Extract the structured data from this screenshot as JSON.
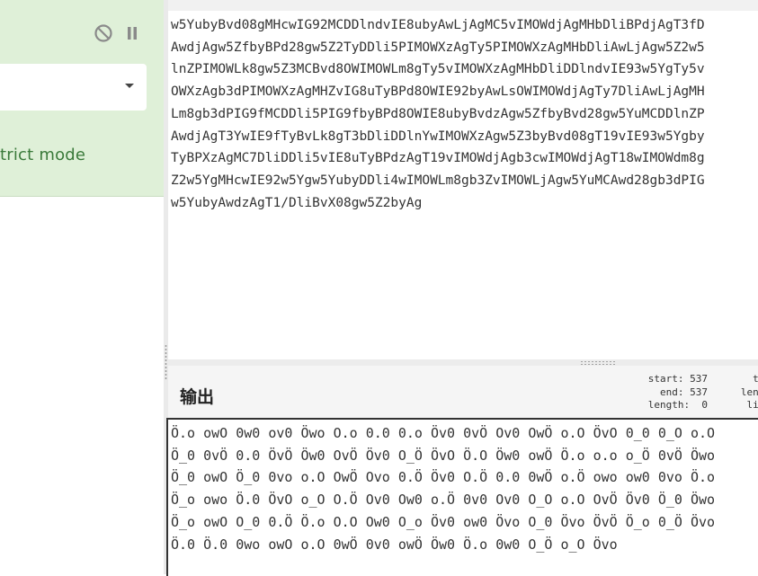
{
  "recipe": {
    "disable_icon": "circle-slash-icon",
    "pause_icon": "pause-icon",
    "select_value": "",
    "strict_mode_label": "trict mode"
  },
  "input": {
    "lines": [
      "w5YubyBvd08gMHcwIG92MCDDlndvIE8ubyAwLjAgMC5vIMOWdjAgMHbDliBPdjAgT3fD",
      "AwdjAgw5ZfbyBPd28gw5Z2TyDDli5PIMOWXzAgTy5PIMOWXzAgMHbDliAwLjAgw5Z2w5",
      "lnZPIMOWLk8gw5Z3MCBvd8OWIMOWLm8gTy5vIMOWXzAgMHbDliDDlndvIE93w5YgTy5v",
      "OWXzAgb3dPIMOWXzAgMHZvIG8uTyBPd8OWIE92byAwLsOWIMOWdjAgTy7DliAwLjAgMH",
      "Lm8gb3dPIG9fMCDDli5PIG9fbyBPd8OWIE8ubyBvdzAgw5ZfbyBvd28gw5YuMCDDlnZP",
      "AwdjAgT3YwIE9fTyBvLk8gT3bDliDDlnYwIMOWXzAgw5Z3byBvd08gT19vIE93w5Ygby",
      "TyBPXzAgMC7DliDDli5vIE8uTyBPdzAgT19vIMOWdjAgb3cwIMOWdjAgT18wIMOWdm8g",
      "Z2w5YgMHcwIE92w5Ygw5YubyDDli4wIMOWLm8gb3ZvIMOWLjAgw5YuMCAwd28gb3dPIG",
      "w5YubyAwdzAgT1/DliBvX08gw5Z2byAg"
    ]
  },
  "output": {
    "title": "输出",
    "stats_left": "start: 537\n  end: 537\nlength:  0",
    "stats_right": "tim\nlengt\nline",
    "lines": [
      "Ö.o owO 0w0 ov0 Öwo O.o 0.0 0.o Öv0 0vÖ Ov0 OwÖ o.O ÖvO 0_0 0_O o.O",
      "Ö_0 0vÖ 0.0 ÖvÖ Öw0 OvÖ Öv0 O_Ö ÖvO Ö.O Öw0 owÖ Ö.o o.o o_Ö 0vÖ Öwo",
      "Ö_0 owO Ö_0 0vo o.O OwÖ Ovo 0.Ö Öv0 O.Ö 0.0 0wÖ o.Ö owo ow0 0vo Ö.o",
      "Ö_o owo Ö.0 ÖvO o_O O.Ö Ov0 Ow0 o.Ö 0v0 Ov0 O_O o.O OvÖ Öv0 Ö_0 Öwo",
      "Ö_o owO O_0 0.Ö Ö.o O.O Ow0 O_o Öv0 ow0 Övo O_0 Övo ÖvÖ Ö_o 0_Ö Övo",
      "Ö.0 Ö.0 0wo owO o.O 0wÖ 0v0 owÖ Öw0 Ö.o 0w0 O_Ö o_O Övo"
    ]
  }
}
